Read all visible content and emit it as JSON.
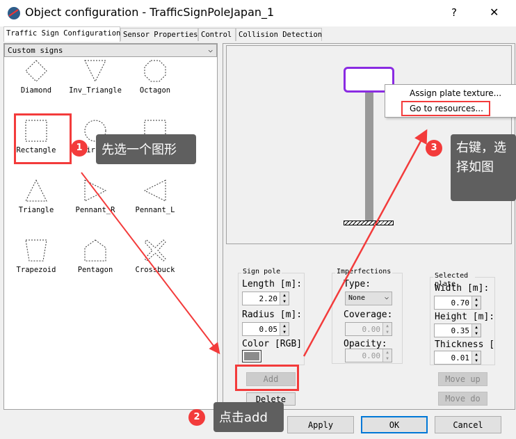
{
  "window": {
    "title": "Object configuration - TrafficSignPoleJapan_1",
    "help": "?",
    "close": "✕"
  },
  "tabs": [
    {
      "label": "Traffic Sign Configuration",
      "selected": true
    },
    {
      "label": "Sensor Properties"
    },
    {
      "label": "Control"
    },
    {
      "label": "Collision Detection"
    }
  ],
  "library": {
    "selected_category": "Custom signs",
    "selected_shape": "Rectangle",
    "shapes": [
      "Diamond",
      "Inv_Triangle",
      "Octagon",
      "Rectangle",
      "Circle",
      "Square",
      "Triangle",
      "Pennant_R",
      "Pennant_L",
      "Trapezoid",
      "Pentagon",
      "Crossbuck"
    ]
  },
  "context_menu": {
    "items": [
      "Assign plate texture...",
      "Go to resources..."
    ]
  },
  "sign_pole": {
    "title": "Sign pole",
    "length_label": "Length [m]:",
    "length": "2.20",
    "radius_label": "Radius [m]:",
    "radius": "0.05",
    "color_label": "Color [RGB]",
    "color": "#8c8c8c"
  },
  "imperfections": {
    "title": "Imperfections",
    "type_label": "Type:",
    "type": "None",
    "coverage_label": "Coverage:",
    "coverage": "0.00",
    "opacity_label": "Opacity:",
    "opacity": "0.00"
  },
  "selected_plate": {
    "title": "Selected plate",
    "width_label": "Width [m]:",
    "width": "0.70",
    "height_label": "Height [m]:",
    "height": "0.35",
    "thickness_label": "Thickness [",
    "thickness": "0.01"
  },
  "buttons": {
    "add": "Add",
    "delete": "Delete",
    "move_up": "Move up",
    "move_down": "Move do",
    "apply": "Apply",
    "ok": "OK",
    "cancel": "Cancel"
  },
  "annotations": [
    {
      "num": "1",
      "text": "先选一个图形"
    },
    {
      "num": "2",
      "text": "点击add"
    },
    {
      "num": "3",
      "text": "右键，选择如图"
    }
  ],
  "colors": {
    "accent": "#f33b3b",
    "plate_highlight": "#8a2be2",
    "ok_focus": "#0078d7"
  }
}
